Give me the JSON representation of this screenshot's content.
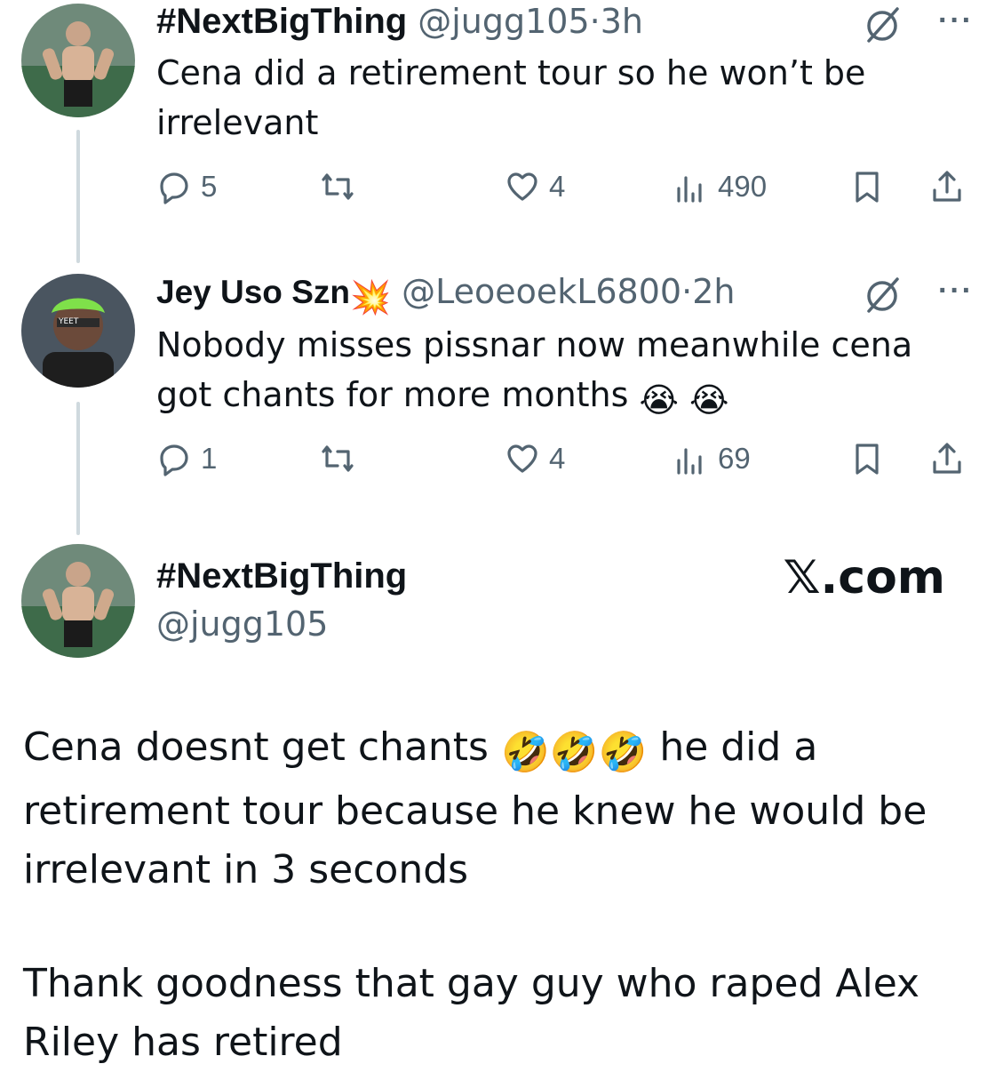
{
  "tweets": [
    {
      "name": "#NextBigThing",
      "handle": "@jugg105",
      "dot": "·",
      "time": "3h",
      "text": "Cena did a retirement tour so he won’t be irrelevant",
      "replies": "5",
      "reposts": "",
      "likes": "4",
      "views": "490"
    },
    {
      "name": "Jey Uso Szn",
      "badge": "💥",
      "handle": "@LeoeoekL6800",
      "dot": "·",
      "time": "2h",
      "text": "Nobody misses pissnar now meanwhile cena got chants for more months",
      "text_emoji": "😭 😭",
      "replies": "1",
      "reposts": "",
      "likes": "4",
      "views": "69"
    }
  ],
  "main": {
    "name": "#NextBigThing",
    "handle": "@jugg105",
    "watermark": "𝕏.com",
    "para1_part1": "Cena doesnt get chants",
    "para1_emoji": "🤣🤣🤣",
    "para1_part2": "he did a retirement tour because he knew he would be irrelevant in 3 seconds",
    "para2": "Thank goodness that gay guy who raped Alex Riley has retired"
  },
  "icons": [
    "reply-icon",
    "repost-icon",
    "like-icon",
    "views-icon",
    "bookmark-icon",
    "share-icon",
    "grok-icon",
    "more-icon"
  ],
  "colors": {
    "text": "#0f1419",
    "secondary": "#536471",
    "thread_line": "#cfd9de"
  }
}
